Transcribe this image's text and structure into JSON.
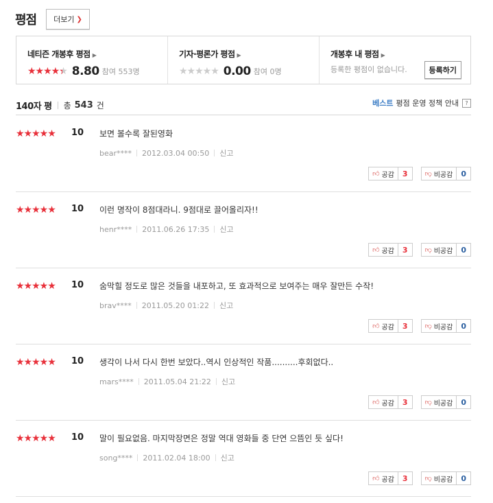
{
  "header": {
    "title": "평점",
    "more_label": "더보기"
  },
  "summary": {
    "netizen": {
      "title": "네티즌 개봉후 평점",
      "score": "8.80",
      "participants": "참여 553명",
      "stars_filled": 4.4
    },
    "critic": {
      "title": "기자·평론가 평점",
      "score": "0.00",
      "participants": "참여 0명",
      "stars_filled": 0
    },
    "mine": {
      "title": "개봉후 내 평점",
      "text": "등록한 평점이 없습니다.",
      "register_label": "등록하기"
    }
  },
  "meta": {
    "label": "140자 평",
    "total_prefix": "총",
    "count": "543",
    "count_suffix": "건",
    "best": "베스트",
    "policy": "평점 운영 정책 안내",
    "help": "?"
  },
  "reviews": [
    {
      "score": "10",
      "text": "보면 볼수록 잘된영화",
      "user": "bear****",
      "date": "2012.03.04 00:50",
      "report": "신고",
      "like_label": "공감",
      "like": "3",
      "dislike_label": "비공감",
      "dislike": "0"
    },
    {
      "score": "10",
      "text": "이런 명작이 8점대라니. 9점대로 끌어올리자!!",
      "user": "henr****",
      "date": "2011.06.26 17:35",
      "report": "신고",
      "like_label": "공감",
      "like": "3",
      "dislike_label": "비공감",
      "dislike": "0"
    },
    {
      "score": "10",
      "text": "숨막힐 정도로 많은 것들을 내포하고, 또 효과적으로 보여주는 매우 잘만든 수작!",
      "user": "brav****",
      "date": "2011.05.20 01:22",
      "report": "신고",
      "like_label": "공감",
      "like": "3",
      "dislike_label": "비공감",
      "dislike": "0"
    },
    {
      "score": "10",
      "text": "생각이 나서 다시 한번 보았다..역시 인상적인 작품..........후회없다..",
      "user": "mars****",
      "date": "2011.05.04 21:22",
      "report": "신고",
      "like_label": "공감",
      "like": "3",
      "dislike_label": "비공감",
      "dislike": "0"
    },
    {
      "score": "10",
      "text": "말이 필요없음. 마지막장면은 정말 역대 영화들 중 단연 으뜸인 듯 싶다!",
      "user": "song****",
      "date": "2011.02.04 18:00",
      "report": "신고",
      "like_label": "공감",
      "like": "3",
      "dislike_label": "비공감",
      "dislike": "0"
    }
  ]
}
